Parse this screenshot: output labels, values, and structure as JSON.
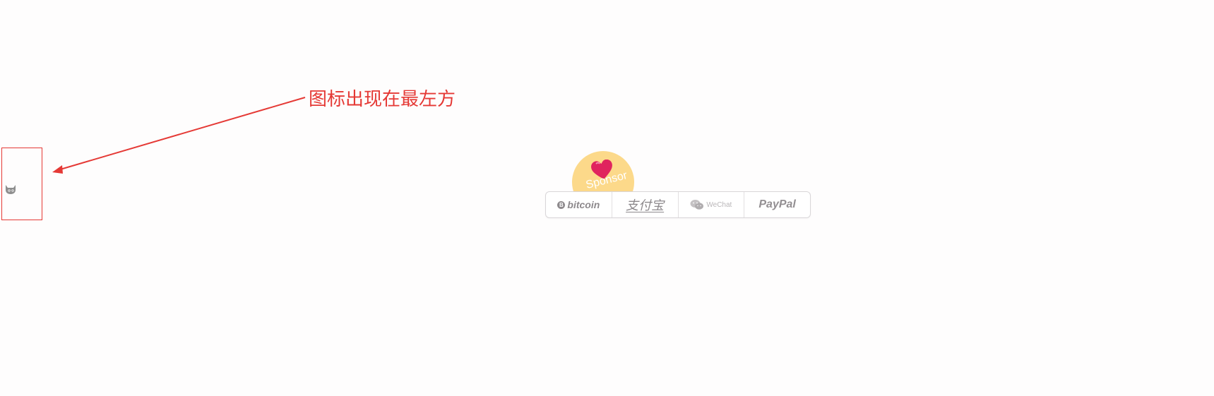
{
  "annotation": {
    "text": "图标出现在最左方",
    "color": "#e53935"
  },
  "left_icon": {
    "icon": "cat-icon"
  },
  "sponsor": {
    "badge_label": "Sponsor",
    "badge_color": "#fcd98a",
    "heart_color": "#e0245e",
    "methods": [
      {
        "label": "bitcoin",
        "coin_symbol": "B",
        "icon": "bitcoin-icon"
      },
      {
        "label": "支付宝",
        "icon": "alipay-icon"
      },
      {
        "label": "WeChat",
        "icon": "wechat-icon"
      },
      {
        "label": "PayPal",
        "icon": "paypal-icon"
      }
    ]
  }
}
